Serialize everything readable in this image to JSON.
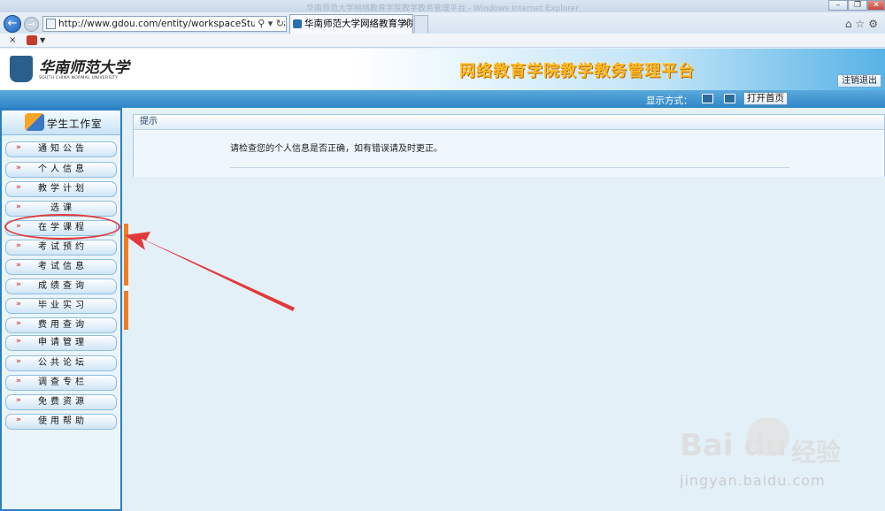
{
  "browser": {
    "title_bar_text": "华南师范大学网络教育学院教学教务管理平台 - Windows Internet Explorer",
    "address": "http://www.gdou.com/entity/workspaceStudent/stude",
    "tab_title": "华南师范大学网络教育学院...",
    "cmd_close": "×",
    "window_buttons": [
      "–",
      "❐",
      "✕"
    ]
  },
  "header": {
    "logo_text": "华南师范大学",
    "logo_sub": "SOUTH CHINA NORMAL UNIVERSITY",
    "platform_title": "网络教育学院教学教务管理平台",
    "logout_label": "注销退出"
  },
  "toolbar": {
    "display_label": "显示方式：",
    "open_home_label": "打开首页"
  },
  "sidebar": {
    "title": "学生工作室",
    "items": [
      {
        "label": "通知公告"
      },
      {
        "label": "个人信息"
      },
      {
        "label": "教学计划"
      },
      {
        "label": "选课"
      },
      {
        "label": "在学课程"
      },
      {
        "label": "考试预约"
      },
      {
        "label": "考试信息"
      },
      {
        "label": "成绩查询"
      },
      {
        "label": "毕业实习"
      },
      {
        "label": "费用查询"
      },
      {
        "label": "申请管理"
      },
      {
        "label": "公共论坛"
      },
      {
        "label": "调查专栏"
      },
      {
        "label": "免费资源"
      },
      {
        "label": "使用帮助"
      }
    ]
  },
  "content": {
    "panel_title": "提示",
    "notice": "请检查您的个人信息是否正确，如有错误请及时更正。"
  },
  "watermark": {
    "brand": "Bai",
    "brand2": "du",
    "cn": "经验",
    "url": "jingyan.baidu.com"
  },
  "annotation": {
    "highlighted_item": "在学课程",
    "color": "#e23a3a"
  }
}
